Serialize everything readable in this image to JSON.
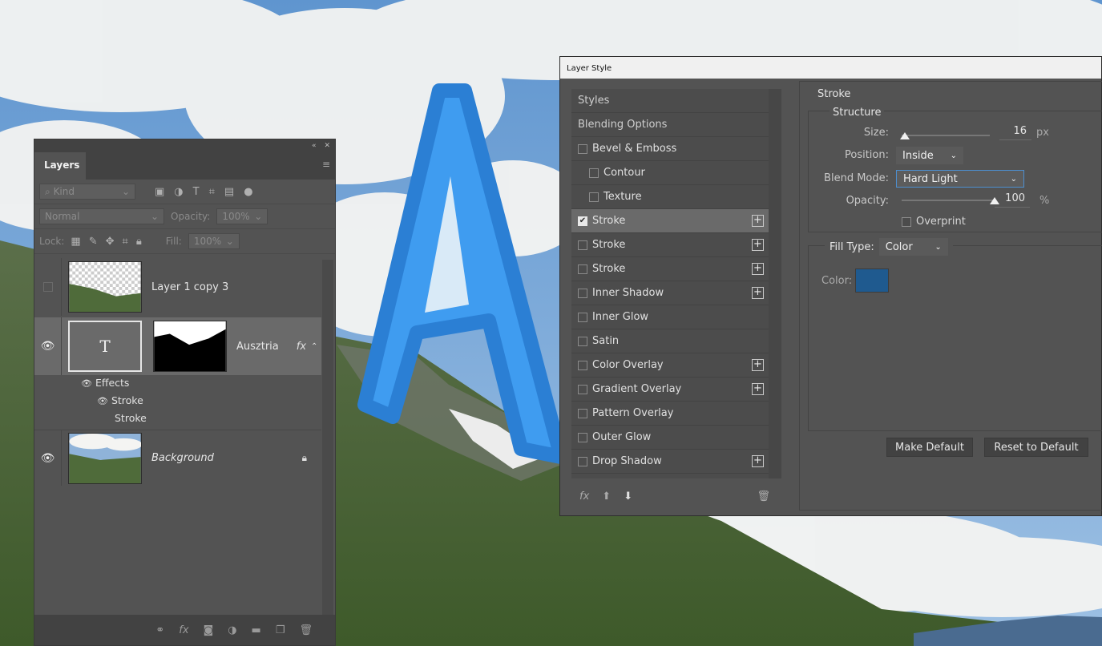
{
  "colors": {
    "stroke_color": "#1f5a8f",
    "letter_fill": "#3f9cf0",
    "letter_stroke": "#2b7fd4",
    "panel_bg": "#535353",
    "focus_blue": "#4d8fd0"
  },
  "canvas_letter": "A",
  "layers_panel": {
    "tab": "Layers",
    "filter_kind": "Kind",
    "blend_mode": "Normal",
    "opacity_label": "Opacity:",
    "opacity_value": "100%",
    "lock_label": "Lock:",
    "fill_label": "Fill:",
    "fill_value": "100%",
    "layers": [
      {
        "name": "Layer 1 copy 3",
        "visible": false
      },
      {
        "name": "Ausztria",
        "visible": true,
        "type_glyph": "T",
        "fx": "fx"
      },
      {
        "name": "Background",
        "visible": true,
        "locked": true
      }
    ],
    "effects_label": "Effects",
    "effect_items": [
      "Stroke",
      "Stroke"
    ]
  },
  "layer_style": {
    "title": "Layer Style",
    "styles": [
      {
        "label": "Styles",
        "kind": "header"
      },
      {
        "label": "Blending Options",
        "kind": "header"
      },
      {
        "label": "Bevel & Emboss",
        "checked": false
      },
      {
        "label": "Contour",
        "checked": false,
        "indent": true
      },
      {
        "label": "Texture",
        "checked": false,
        "indent": true
      },
      {
        "label": "Stroke",
        "checked": true,
        "plus": true,
        "active": true
      },
      {
        "label": "Stroke",
        "checked": false,
        "plus": true
      },
      {
        "label": "Stroke",
        "checked": false,
        "plus": true
      },
      {
        "label": "Inner Shadow",
        "checked": false,
        "plus": true
      },
      {
        "label": "Inner Glow",
        "checked": false
      },
      {
        "label": "Satin",
        "checked": false
      },
      {
        "label": "Color Overlay",
        "checked": false,
        "plus": true
      },
      {
        "label": "Gradient Overlay",
        "checked": false,
        "plus": true
      },
      {
        "label": "Pattern Overlay",
        "checked": false
      },
      {
        "label": "Outer Glow",
        "checked": false
      },
      {
        "label": "Drop Shadow",
        "checked": false,
        "plus": true
      }
    ],
    "fx_label": "fx",
    "stroke_heading": "Stroke",
    "structure_heading": "Structure",
    "size_label": "Size:",
    "size_value": "16",
    "size_unit": "px",
    "size_fraction": 0.04,
    "position_label": "Position:",
    "position_value": "Inside",
    "blend_mode_label": "Blend Mode:",
    "blend_mode_value": "Hard Light",
    "opacity_label": "Opacity:",
    "opacity_value": "100",
    "opacity_unit": "%",
    "opacity_fraction": 1.0,
    "overprint_label": "Overprint",
    "fill_type_label": "Fill Type:",
    "fill_type_value": "Color",
    "color_label": "Color:",
    "make_default": "Make Default",
    "reset_default": "Reset to Default"
  }
}
